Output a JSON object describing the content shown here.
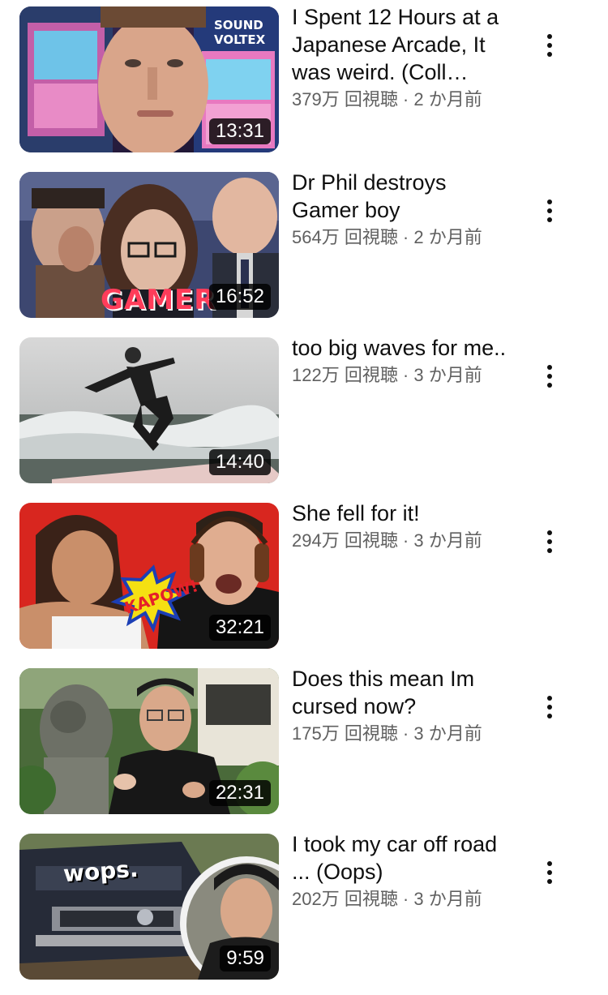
{
  "colors": {
    "title_text": "#0f0f0f",
    "meta_text": "#606060",
    "duration_bg": "#000000",
    "duration_text": "#ffffff",
    "background": "#ffffff"
  },
  "videos": [
    {
      "title": "I Spent 12 Hours at a Japanese Arcade, It was weird. (Coll…",
      "stats": "379万 回視聴 · 2 か月前",
      "duration": "13:31",
      "thumbnail_overlay_text": "SOUND VOLTEX",
      "menu_icon": "more-vert-icon"
    },
    {
      "title": "Dr Phil destroys Gamer boy",
      "stats": "564万 回視聴 · 2 か月前",
      "duration": "16:52",
      "thumbnail_overlay_text": "GAMER",
      "menu_icon": "more-vert-icon"
    },
    {
      "title": "too big waves for me..",
      "stats": "122万 回視聴 · 3 か月前",
      "duration": "14:40",
      "thumbnail_overlay_text": "",
      "menu_icon": "more-vert-icon"
    },
    {
      "title": "She fell for it!",
      "stats": "294万 回視聴 · 3 か月前",
      "duration": "32:21",
      "thumbnail_overlay_text": "KAPOW!",
      "menu_icon": "more-vert-icon"
    },
    {
      "title": "Does this mean Im cursed now?",
      "stats": "175万 回視聴 · 3 か月前",
      "duration": "22:31",
      "thumbnail_overlay_text": "",
      "menu_icon": "more-vert-icon"
    },
    {
      "title": "I took my car off road ... (Oops)",
      "stats": "202万 回視聴 · 3 か月前",
      "duration": "9:59",
      "thumbnail_overlay_text": "wops.",
      "menu_icon": "more-vert-icon"
    }
  ]
}
